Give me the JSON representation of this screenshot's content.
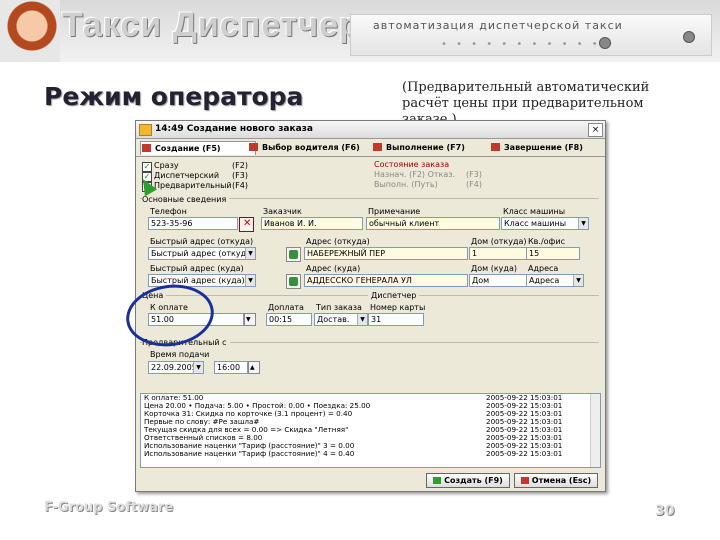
{
  "slide": {
    "brand": "Такси Диспетчер",
    "tagline": "автоматизация диспетчерской такси",
    "title": "Режим оператора",
    "note": "(Предварительный автоматический расчёт цены при предварительном заказе )",
    "footer_brand": "F-Group Software",
    "page_number": "30"
  },
  "window": {
    "title": "14:49 Создание нового заказа",
    "close": "×",
    "tabs": [
      {
        "label": "Создание (F5)"
      },
      {
        "label": "Выбор водителя (F6)"
      },
      {
        "label": "Выполнение (F7)"
      },
      {
        "label": "Завершение (F8)"
      }
    ],
    "order_types": [
      {
        "label": "Сразу",
        "key": "(F2)",
        "checked": "✓"
      },
      {
        "label": "Диспетчерский",
        "key": "(F3)",
        "checked": "✓"
      },
      {
        "label": "Предварительный",
        "key": "(F4)",
        "checked": "✓"
      }
    ],
    "status_panel": {
      "title": "Состояние заказа",
      "rows": [
        {
          "label": "Назнач. (F2)   Отказ.",
          "key": "(F3)"
        },
        {
          "label": "Выполн. (Путь)",
          "key": "(F4)"
        }
      ]
    },
    "section_order": "Основные сведения",
    "fields": {
      "phone_label": "Телефон",
      "phone": "523-35-96",
      "customer_label": "Заказчик",
      "customer": "Иванов И. И.",
      "note_label": "Примечание",
      "note": "обычный клиент",
      "class_label": "Класс машины",
      "class": "Класс машины",
      "quick_from_label": "Быстрый адрес (откуда)",
      "quick_from": "Быстрый адрес (откуда)",
      "addr_from_label": "Адрес (откуда)",
      "addr_from": "НАБЕРЕЖНЫЙ ПЕР",
      "house_from_label": "Дом (откуда)",
      "house_from": "1",
      "apt_label": "Кв./офис",
      "apt": "15",
      "quick_to_label": "Быстрый адрес (куда)",
      "quick_to": "Быстрый адрес (куда)",
      "addr_to_label": "Адрес (куда)",
      "addr_to": "АДДЕССКО ГЕНЕРАЛА УЛ",
      "house_to_label": "Дом (куда)",
      "house_to": "Дом",
      "area_label": "Адреса",
      "area": "Адреса"
    },
    "section_price": "Цена",
    "section_payment": "Диспетчер",
    "price_label": "К оплате",
    "price": "51.00",
    "extra_label": "Доплата",
    "extra": "00:15",
    "order_kind_label": "Тип заказа",
    "order_kind": "Достав.",
    "card_label": "Номер карты",
    "card": "31",
    "section_prelim": "Предварительный с",
    "time_label": "Время подачи",
    "date": "22.09.2005",
    "time": "16:00",
    "log": [
      {
        "text": "К оплате: 51.00",
        "date": "2005-09-22 15:03:01"
      },
      {
        "text": "Цена 20.00 • Подача: 5.00 • Простой: 0.00 • Поездка: 25.00",
        "date": "2005-09-22 15:03:01"
      },
      {
        "text": "Корточка 31: Скидка по корточке (3.1 процент) = 0.40",
        "date": "2005-09-22 15:03:01"
      },
      {
        "text": "Первые по слову: #Ре зашла#",
        "date": "2005-09-22 15:03:01"
      },
      {
        "text": "Текущая скидка для всех = 0.00 => Скидка \"Летняя\"",
        "date": "2005-09-22 15:03:01"
      },
      {
        "text": "Ответственный списков = 8.00",
        "date": "2005-09-22 15:03:01"
      },
      {
        "text": "Использование наценки \"Тариф (расстояние)\" 3 = 0.00",
        "date": "2005-09-22 15:03:01"
      },
      {
        "text": "Использование наценки \"Тариф (расстояние)\" 4 = 0.40",
        "date": "2005-09-22 15:03:01"
      }
    ],
    "buttons": {
      "create": "Создать (F9)",
      "cancel": "Отмена (Esc)"
    }
  },
  "colors": {
    "accent": "#1b2f9c",
    "tab_icon_red": "#c0392b",
    "check_green": "#1c8a1c",
    "window_bg": "#ece9d8"
  }
}
